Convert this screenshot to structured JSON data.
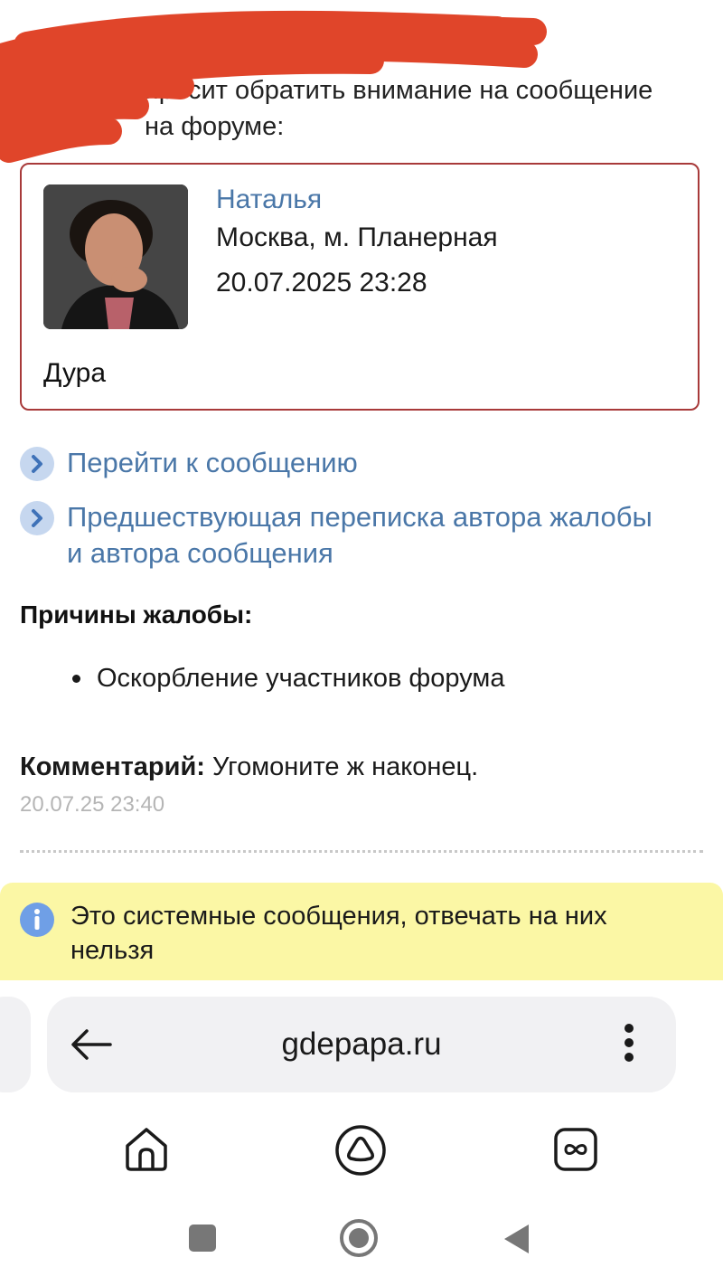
{
  "header": {
    "text": "просит обратить внимание на сообщение на форуме:"
  },
  "post": {
    "author": "Наталья",
    "location": "Москва, м. Планерная",
    "date": "20.07.2025 23:28",
    "text": "Дура"
  },
  "links": [
    {
      "label": "Перейти к сообщению"
    },
    {
      "label": "Предшествующая переписка автора жалобы и автора сообщения"
    }
  ],
  "reasons": {
    "title": "Причины жалобы:",
    "items": [
      "Оскорбление участников форума"
    ]
  },
  "comment": {
    "label": "Комментарий:",
    "text": " Угомоните ж наконец.",
    "time": "20.07.25 23:40"
  },
  "notice": {
    "text": "Это системные сообщения, отвечать на них нельзя"
  },
  "browser": {
    "url": "gdepapa.ru"
  },
  "colors": {
    "link": "#4a77a8",
    "card_border": "#a83a3a",
    "notice_bg": "#fbf7a5",
    "info_icon": "#6f9fe6",
    "redaction": "#e0452a"
  },
  "icons": {
    "back": "arrow-left-icon",
    "menu": "vertical-dots-icon",
    "home": "home-icon",
    "alice": "alice-assistant-icon",
    "tabs": "tabs-infinity-icon",
    "info": "info-icon"
  }
}
